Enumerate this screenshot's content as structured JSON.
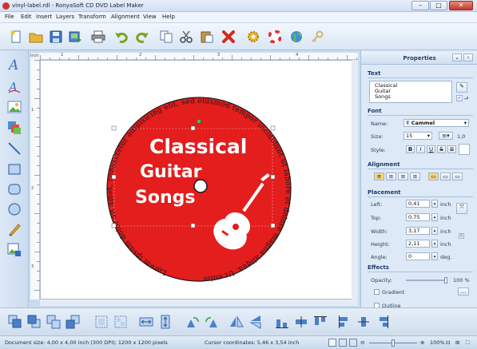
{
  "window": {
    "title": "vinyl-label.rdl - RonyaSoft CD DVD Label Maker",
    "minimize": "–",
    "maximize": "□",
    "close": "✕"
  },
  "menu": [
    "File",
    "Edit",
    "Insert",
    "Layers",
    "Transform",
    "Alignment",
    "View",
    "Help"
  ],
  "toolbar_icons": [
    "new-icon",
    "open-icon",
    "save-icon",
    "export-icon",
    "print-icon",
    "undo-icon",
    "redo-icon",
    "copy-icon",
    "cut-icon",
    "paste-icon",
    "delete-icon",
    "settings-icon",
    "help-icon",
    "web-icon",
    "key-icon"
  ],
  "left_tools": [
    "text-tool-icon",
    "curved-text-tool-icon",
    "image-tool-icon",
    "background-tool-icon",
    "line-tool-icon",
    "rectangle-tool-icon",
    "rounded-rect-tool-icon",
    "ellipse-tool-icon",
    "pencil-tool-icon",
    "add-image-tool-icon"
  ],
  "ruler": {
    "unit": "inch",
    "top_ticks": [
      "1",
      "2",
      "3",
      "4"
    ],
    "left_ticks": [
      "1",
      "2",
      "3"
    ]
  },
  "label": {
    "title_lines": [
      "Classical",
      "Guitar",
      "Songs"
    ],
    "arc_text": "Lorem ipsum dolor sit amet, consectetur adipisicing elit, sed eiusmod tempor incididunt ut labore et dolore magna aliqua. Ut enim ad minim",
    "colors": {
      "disc": "#e41d1d",
      "text": "#ffffff",
      "arc_text": "#1a1a1a"
    }
  },
  "properties": {
    "header": "Properties",
    "text_section": "Text",
    "text_value_lines": [
      "Classical",
      "Guitar",
      "Songs"
    ],
    "font_section": "Font",
    "name_label": "Name:",
    "font_name": "Cammel",
    "size_label": "Size:",
    "font_size": "15",
    "line_spacing": "1,0",
    "style_label": "Style:",
    "style_buttons": [
      "B",
      "I",
      "U",
      "S"
    ],
    "alignment_section": "Alignment",
    "placement_section": "Placement",
    "left_label": "Left:",
    "left_value": "0,41",
    "top_label": "Top:",
    "top_value": "0,75",
    "width_label": "Width:",
    "width_value": "3,17",
    "height_label": "Height:",
    "height_value": "2,11",
    "angle_label": "Angle:",
    "angle_value": "0",
    "unit_inch": "inch",
    "unit_deg": "deg.",
    "effects_section": "Effects",
    "opacity_label": "Opacity:",
    "opacity_value": "100 %",
    "gradient_label": "Gradient",
    "outline_label": "Outline"
  },
  "bottom_tools": [
    "bring-front-icon",
    "send-back-icon",
    "group-icon",
    "ungroup-icon",
    "select-all-icon",
    "fit-width-icon",
    "fit-height-icon",
    "flip-horizontal-icon",
    "flip-vertical-icon",
    "rotate-left-icon",
    "rotate-right-icon",
    "align-top-icon",
    "align-middle-icon",
    "align-bottom-icon",
    "align-left-icon",
    "align-center-icon",
    "align-right-icon"
  ],
  "status": {
    "document_size": "Document size: 4,00 x 4,00 inch (300 DPI); 1200 x 1200 pixels",
    "cursor": "Cursor coordinates: 5,46 x 3,54 inch",
    "zoom": "100%"
  }
}
